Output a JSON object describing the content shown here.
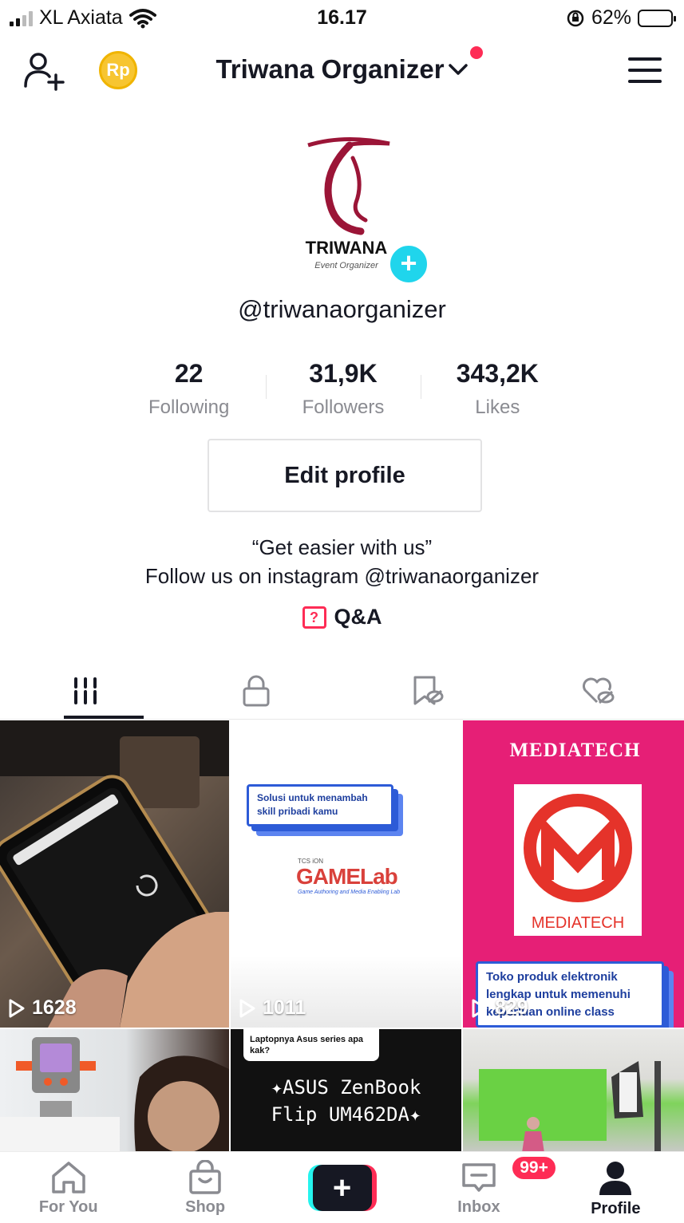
{
  "status_bar": {
    "carrier": "XL Axiata",
    "time": "16.17",
    "battery_percent": "62%",
    "battery_level": 0.62,
    "icons": [
      "signal-icon",
      "wifi-icon",
      "rotation-lock-icon",
      "battery-icon"
    ]
  },
  "header": {
    "account_name": "Triwana Organizer",
    "coin_label": "Rp",
    "icons": [
      "add-user-icon",
      "coin-icon",
      "chevron-down-icon",
      "menu-icon"
    ]
  },
  "profile": {
    "logo_text": "TRIWANA",
    "logo_subtext": "Event Organizer",
    "username": "@triwanaorganizer",
    "stats": [
      {
        "value": "22",
        "label": "Following"
      },
      {
        "value": "31,9K",
        "label": "Followers"
      },
      {
        "value": "343,2K",
        "label": "Likes"
      }
    ],
    "edit_button": "Edit profile",
    "bio_line1": "“Get easier with us”",
    "bio_line2": "Follow us on instagram @triwanaorganizer",
    "qa_label": "Q&A"
  },
  "tabs": [
    "videos-grid-icon",
    "private-lock-icon",
    "favorites-hidden-icon",
    "liked-hidden-icon"
  ],
  "videos": [
    {
      "views": "1628"
    },
    {
      "views": "1011",
      "promo_text": "Solusi untuk menambah skill pribadi kamu",
      "brand": "GAMELab",
      "brand_sub": "Game Authoring and Media Enabling Lab",
      "brand_top": "TCS iON"
    },
    {
      "views": "829",
      "headline": "MEDIATECH",
      "brand": "MEDIATECH",
      "promo_text_1": "Toko produk elektronik",
      "promo_text_2": "lengkap untuk memenuhi",
      "promo_text_3": "keperluan online class"
    },
    {
      "caption": "Laptopnya Asus series apa kak?",
      "title_1": "ASUS ZenBook",
      "title_2": "Flip UM462DA"
    },
    {},
    {}
  ],
  "bottom_nav": [
    {
      "label": "For You",
      "icon": "home-icon"
    },
    {
      "label": "Shop",
      "icon": "shop-bag-icon"
    },
    {
      "label": "",
      "icon": "create-plus-icon"
    },
    {
      "label": "Inbox",
      "icon": "inbox-icon",
      "badge": "99+"
    },
    {
      "label": "Profile",
      "icon": "profile-icon"
    }
  ],
  "colors": {
    "accent": "#fe2c55",
    "cyan": "#25f4ee",
    "text": "#161823",
    "muted": "#8a8b91"
  }
}
